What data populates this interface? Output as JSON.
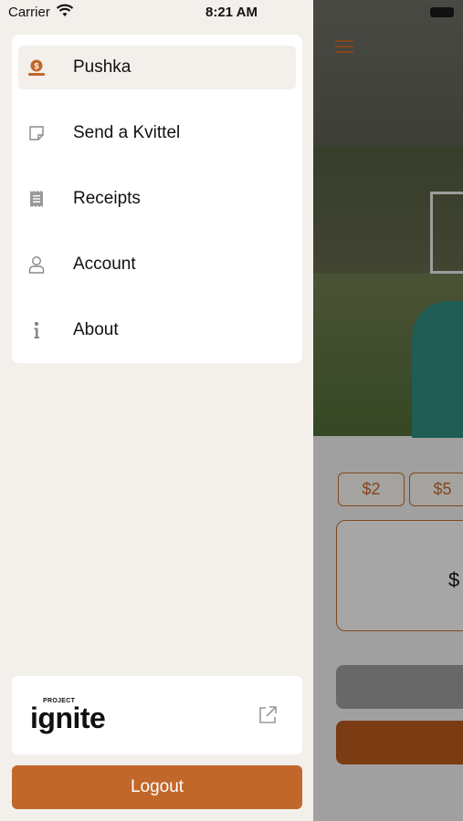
{
  "status_bar": {
    "carrier": "Carrier",
    "time": "8:21 AM"
  },
  "drawer": {
    "menu": [
      {
        "label": "Pushka",
        "icon": "pushka-coin-icon",
        "active": true
      },
      {
        "label": "Send a Kvittel",
        "icon": "note-icon",
        "active": false
      },
      {
        "label": "Receipts",
        "icon": "receipt-icon",
        "active": false
      },
      {
        "label": "Account",
        "icon": "person-icon",
        "active": false
      },
      {
        "label": "About",
        "icon": "info-icon",
        "active": false
      }
    ],
    "brand": {
      "small_text": "PROJECT",
      "logo_text": "ignite",
      "link_icon": "external-link-icon"
    },
    "logout_label": "Logout"
  },
  "background_app": {
    "amounts": [
      "$2",
      "$5"
    ],
    "currency_symbol": "$"
  },
  "colors": {
    "accent": "#c2672b",
    "drawer_bg": "#f3f0ec",
    "card_bg": "#ffffff"
  }
}
